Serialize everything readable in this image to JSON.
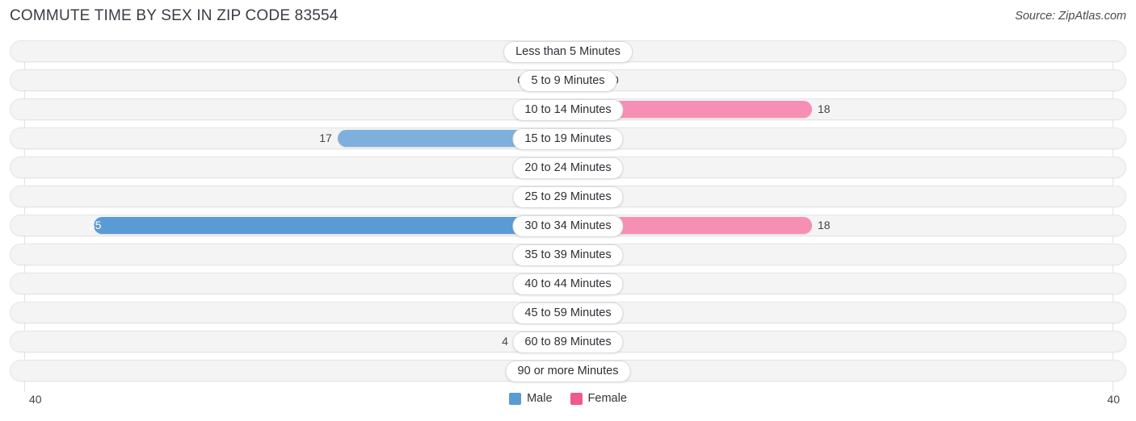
{
  "header": {
    "title": "COMMUTE TIME BY SEX IN ZIP CODE 83554",
    "source": "Source: ZipAtlas.com"
  },
  "axis": {
    "left_label": "40",
    "right_label": "40"
  },
  "legend": {
    "items": [
      {
        "label": "Male",
        "color": "#5b9bd5",
        "icon": "male-swatch"
      },
      {
        "label": "Female",
        "color": "#f0588e",
        "icon": "female-swatch"
      }
    ]
  },
  "colors": {
    "male_light": "#9dc3e6",
    "male_mid": "#7fb0dd",
    "male_strong": "#5b9bd5",
    "female_light": "#f79dc0",
    "female_mid": "#f78fb5",
    "female_strong": "#f0588e",
    "track": "#f4f4f4",
    "track_border": "#e4e4e4",
    "gridline": "#e2e2e2"
  },
  "chart_data": {
    "type": "bar",
    "subtype": "diverging-bar",
    "title": "COMMUTE TIME BY SEX IN ZIP CODE 83554",
    "xlabel": "",
    "ylabel": "",
    "xlim": [
      40,
      40
    ],
    "axis_max": 40,
    "grid": true,
    "legend_position": "bottom-center",
    "categories": [
      "Less than 5 Minutes",
      "5 to 9 Minutes",
      "10 to 14 Minutes",
      "15 to 19 Minutes",
      "20 to 24 Minutes",
      "25 to 29 Minutes",
      "30 to 34 Minutes",
      "35 to 39 Minutes",
      "40 to 44 Minutes",
      "45 to 59 Minutes",
      "60 to 89 Minutes",
      "90 or more Minutes"
    ],
    "series": [
      {
        "name": "Male",
        "color": "#5b9bd5",
        "direction": "left",
        "values": [
          0,
          0,
          2,
          17,
          0,
          0,
          35,
          2,
          0,
          0,
          4,
          0
        ]
      },
      {
        "name": "Female",
        "color": "#f0588e",
        "direction": "right",
        "values": [
          3,
          0,
          18,
          0,
          2,
          0,
          18,
          0,
          0,
          0,
          0,
          0
        ]
      }
    ]
  }
}
